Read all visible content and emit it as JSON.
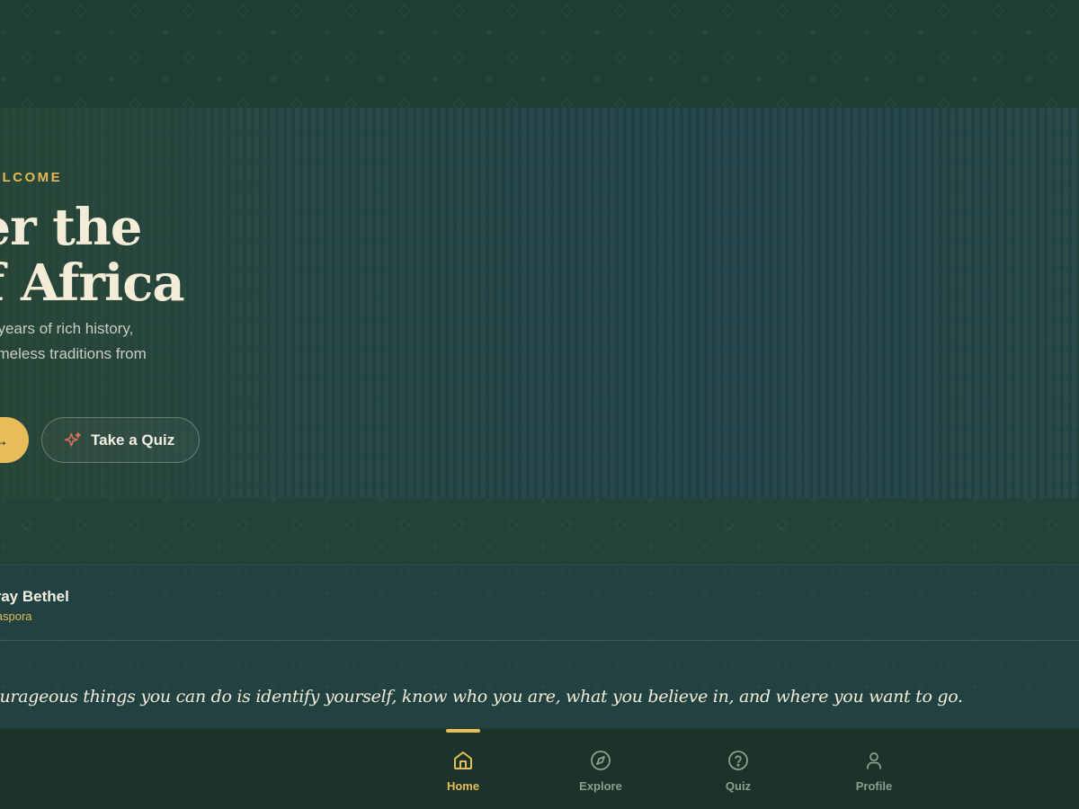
{
  "colors": {
    "accent": "#e7bd5a",
    "background": "#1f3a30",
    "text": "#f4ecd6"
  },
  "hero": {
    "eyebrow": "ELCOME",
    "headline_line1": "ver the",
    "headline_line2": "of Africa",
    "subtitle_line1": "f years of rich history,",
    "subtitle_line2": "timeless traditions from",
    "primary_button_icon": "arrow-right-icon",
    "secondary_button": {
      "label": "Take a Quiz",
      "icon": "sparkle-icon"
    }
  },
  "quote": {
    "author": "rray Bethel",
    "tag": "liaspora",
    "text": "courageous things you can do is identify yourself, know who you are, what you believe in, and where you want to go."
  },
  "nav": {
    "active": "Home",
    "tabs": [
      {
        "label": "Home",
        "icon": "home-icon"
      },
      {
        "label": "Explore",
        "icon": "compass-icon"
      },
      {
        "label": "Quiz",
        "icon": "help-circle-icon"
      },
      {
        "label": "Profile",
        "icon": "user-icon"
      }
    ]
  }
}
